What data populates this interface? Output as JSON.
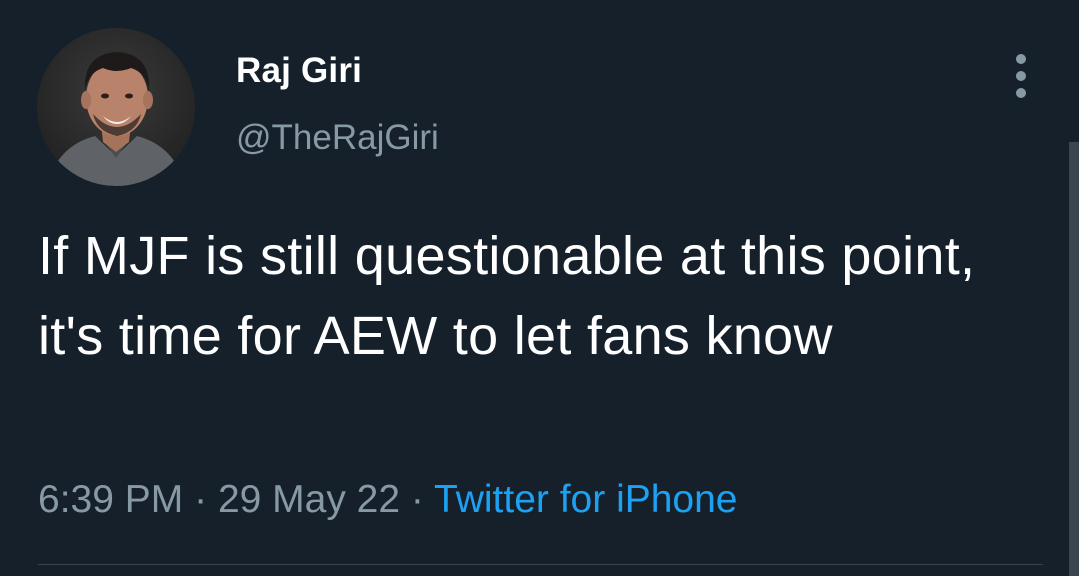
{
  "user": {
    "display_name": "Raj Giri",
    "handle": "@TheRajGiri"
  },
  "tweet": {
    "text": "If MJF is still questionable at this point, it's time for AEW to let fans know"
  },
  "meta": {
    "time": "6:39 PM",
    "sep1": "·",
    "date": "29 May 22",
    "sep2": "·",
    "source": "Twitter for iPhone"
  },
  "colors": {
    "background": "#15202b",
    "primary_text": "#ffffff",
    "secondary_text": "#8899a6",
    "link": "#1da1f2"
  },
  "icons": {
    "more": "more-vertical-icon",
    "avatar": "profile-photo"
  }
}
